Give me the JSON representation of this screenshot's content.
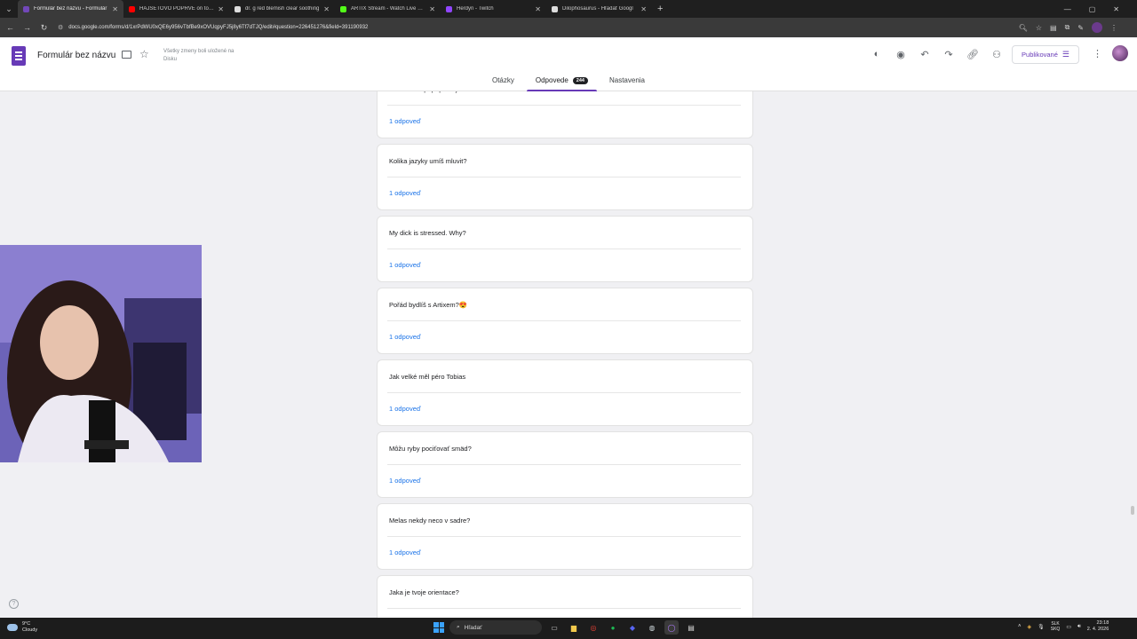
{
  "browser": {
    "tabs": [
      {
        "title": "Formulár bez názvu - Formulár",
        "color": "#7248b9",
        "active": true
      },
      {
        "title": "HAJSETOVO POPRVÉ on to fak",
        "color": "#ff0000",
        "active": false
      },
      {
        "title": "dr. g red blemish clear soothing",
        "color": "#dddddd",
        "active": false
      },
      {
        "title": "ARTIX Stream - Watch Live on K",
        "color": "#53fc18",
        "active": false
      },
      {
        "title": "Herdyn - Twitch",
        "color": "#9146ff",
        "active": false
      },
      {
        "title": "Dilophosaurus - Hľadať Googl",
        "color": "#dddddd",
        "active": false
      }
    ],
    "url": "docs.google.com/forms/d/1xrPdWU0xQE6y956vTbfBe9xOVUqpyFJ5j8y6Tf7dTJQ/edit#question=226451276&field=391190932"
  },
  "header": {
    "title": "Formulár bez názvu",
    "save_status": "Všetky zmeny boli uložené na Disku",
    "publish_label": "Publikované"
  },
  "form_tabs": [
    {
      "label": "Otázky",
      "active": false
    },
    {
      "label": "Odpovede",
      "active": true,
      "badge": "244"
    },
    {
      "label": "Nastavenia",
      "active": false
    }
  ],
  "questions": [
    {
      "title": "Máš auto a popřípadě jaké.",
      "responses": "1 odpoveď"
    },
    {
      "title": "Kolika jazyky umíš mluvit?",
      "responses": "1 odpoveď"
    },
    {
      "title": "My dick is stressed. Why?",
      "responses": "1 odpoveď"
    },
    {
      "title": "Pořád bydlíš s Artixem?😍",
      "responses": "1 odpoveď"
    },
    {
      "title": "Jak velké měl péro Tobias",
      "responses": "1 odpoveď"
    },
    {
      "title": "Môžu ryby pociťovať smäd?",
      "responses": "1 odpoveď"
    },
    {
      "title": "Melas nekdy neco v sadre?",
      "responses": "1 odpoveď"
    },
    {
      "title": "Jaka je tvoje orientace?",
      "responses": ""
    }
  ],
  "taskbar": {
    "weather_temp": "9°C",
    "weather_desc": "Cloudy",
    "search_label": "Hľadať",
    "lang_top": "SLK",
    "lang_bottom": "SKQ",
    "time": "23:18",
    "date": "2. 4. 2026"
  },
  "colors": {
    "accent": "#673ab7",
    "link": "#1a73e8"
  }
}
